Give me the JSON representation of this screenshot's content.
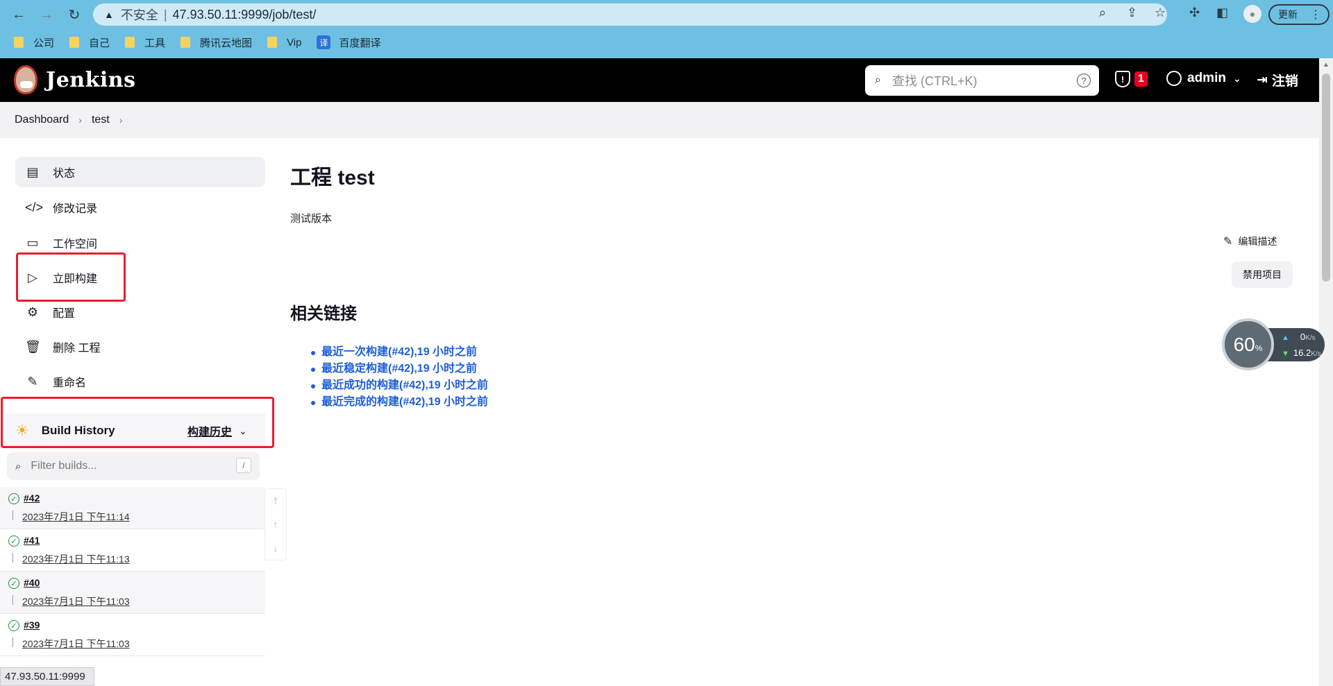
{
  "browser": {
    "insecure_label": "不安全",
    "url": "47.93.50.11:9999/job/test/",
    "update_label": "更新",
    "bookmarks": [
      "公司",
      "自己",
      "工具",
      "腾讯云地图",
      "Vip",
      "百度翻译"
    ],
    "translate_glyph": "译",
    "status_url": "47.93.50.11:9999"
  },
  "header": {
    "app_name": "Jenkins",
    "search_placeholder": "查找 (CTRL+K)",
    "security_count": "1",
    "user": "admin",
    "logout": "注销"
  },
  "breadcrumb": [
    "Dashboard",
    "test"
  ],
  "sidebar": {
    "items": [
      {
        "label": "状态",
        "icon": "document-icon"
      },
      {
        "label": "修改记录",
        "icon": "code-icon"
      },
      {
        "label": "工作空间",
        "icon": "folder-icon"
      },
      {
        "label": "立即构建",
        "icon": "play-icon"
      },
      {
        "label": "配置",
        "icon": "gear-icon"
      },
      {
        "label": "删除 工程",
        "icon": "trash-icon"
      },
      {
        "label": "重命名",
        "icon": "pencil-icon"
      }
    ]
  },
  "build_history": {
    "title": "Build History",
    "trend_label": "构建历史",
    "filter_placeholder": "Filter builds...",
    "filter_shortcut": "/",
    "builds": [
      {
        "number": "#42",
        "date": "2023年7月1日 下午11:14"
      },
      {
        "number": "#41",
        "date": "2023年7月1日 下午11:13"
      },
      {
        "number": "#40",
        "date": "2023年7月1日 下午11:03"
      },
      {
        "number": "#39",
        "date": "2023年7月1日 下午11:03"
      }
    ]
  },
  "main": {
    "title": "工程 test",
    "description": "测试版本",
    "edit_description": "编辑描述",
    "disable_project": "禁用项目",
    "related_links_title": "相关链接",
    "related_links": [
      "最近一次构建(#42),19 小时之前",
      "最近稳定构建(#42),19 小时之前",
      "最近成功的构建(#42),19 小时之前",
      "最近完成的构建(#42),19 小时之前"
    ]
  },
  "speed_widget": {
    "percent": "60",
    "percent_sign": "%",
    "upload": "0",
    "download": "16.2",
    "unit": "K/s"
  },
  "colors": {
    "browser_chrome": "#6ec0e3",
    "jenkins_header": "#000000",
    "link": "#1c5ed6",
    "highlight_box": "#ea1c2b",
    "success": "#1a8f3b"
  }
}
